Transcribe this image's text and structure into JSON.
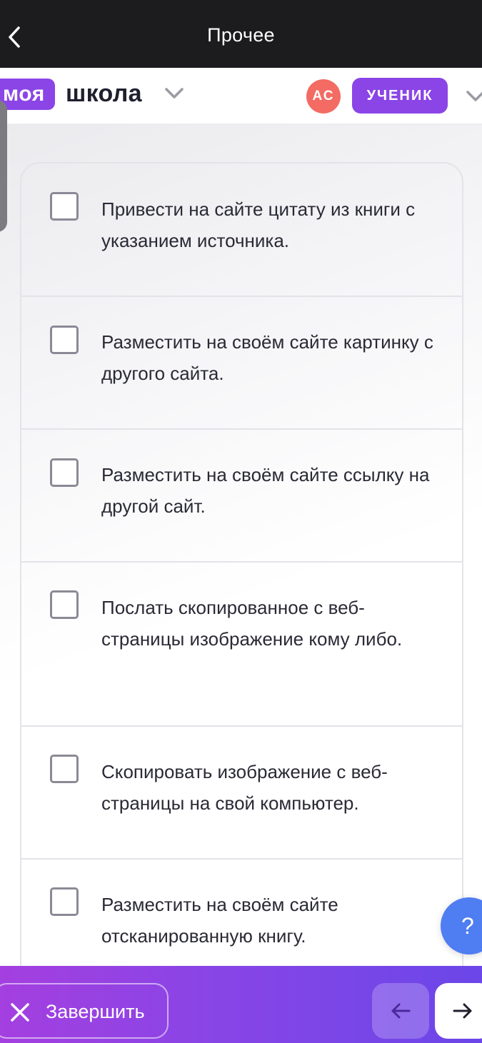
{
  "topbar": {
    "title": "Прочее",
    "back_icon": "chevron-left-icon"
  },
  "header": {
    "logo_badge": "моя",
    "logo_text": "школа",
    "avatar_initials": "АС",
    "role": "УЧЕНИК"
  },
  "options": [
    {
      "text": "Привести на сайте цитату из книги с указанием источника.",
      "checked": false
    },
    {
      "text": "Разместить на своём сайте картинку с другого сайта.",
      "checked": false
    },
    {
      "text": "Разместить на своём сайте ссылку на другой сайт.",
      "checked": false
    },
    {
      "text": "Послать скопированное с веб-страницы изображение кому либо.",
      "checked": false
    },
    {
      "text": "Скопировать изображение с веб-страницы на свой компьютер.",
      "checked": false
    },
    {
      "text": "Разместить на своём сайте отсканированную книгу.",
      "checked": false
    }
  ],
  "help": {
    "label": "?"
  },
  "footer": {
    "finish_label": "Завершить"
  },
  "colors": {
    "accent": "#8b45e6",
    "avatar": "#f36b63",
    "help": "#4f7df2",
    "topbar": "#1c1c1e"
  }
}
